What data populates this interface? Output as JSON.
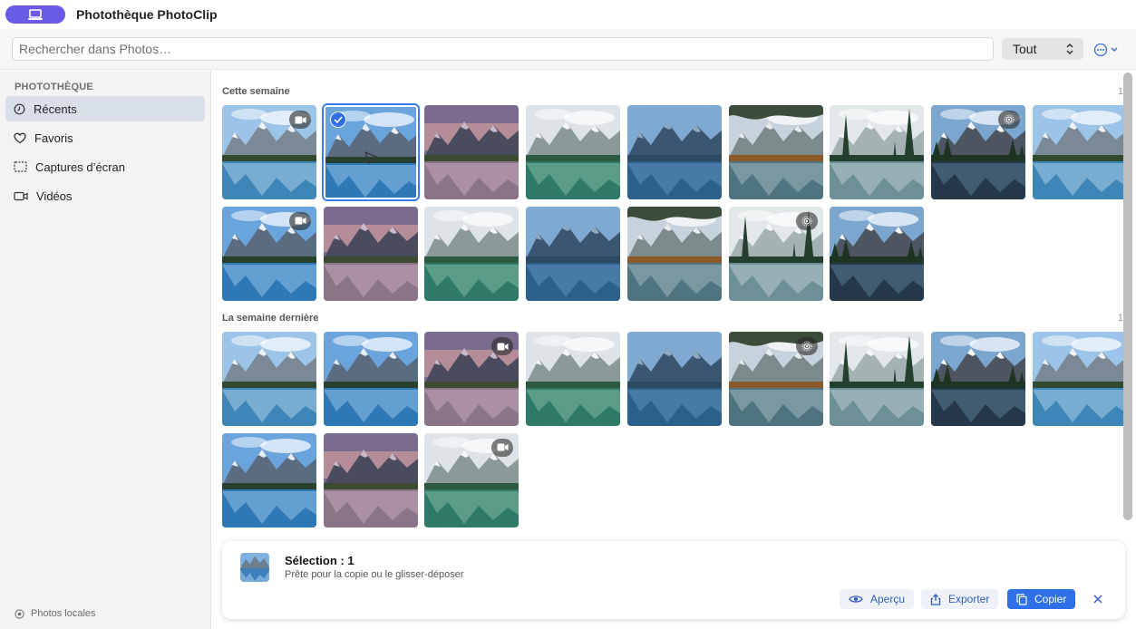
{
  "window": {
    "title": "Photothèque PhotoClip",
    "app_pill_icon": "laptop-icon"
  },
  "toolbar": {
    "search_placeholder": "Rechercher dans Photos…",
    "filter_value": "Tout",
    "more_icon": "ellipsis-circle-icon"
  },
  "sidebar": {
    "heading": "PHOTOTHÈQUE",
    "items": [
      {
        "label": "Récents",
        "icon": "clock-icon",
        "active": true
      },
      {
        "label": "Favoris",
        "icon": "heart-icon",
        "active": false
      },
      {
        "label": "Captures d’écran",
        "icon": "screenshot-icon",
        "active": false
      },
      {
        "label": "Vidéos",
        "icon": "video-icon",
        "active": false
      }
    ],
    "footer": "Photos locales"
  },
  "sections": [
    {
      "title": "Cette semaine",
      "count": "1",
      "photos": [
        {
          "scene": "lake-moraine",
          "badge": "video"
        },
        {
          "scene": "lake-moraine-blue",
          "badge": "none",
          "selected": true
        },
        {
          "scene": "sunset-peaks",
          "badge": "none"
        },
        {
          "scene": "misty-lake",
          "badge": "none"
        },
        {
          "scene": "blue-lake",
          "badge": "none"
        },
        {
          "scene": "autumn-forest",
          "badge": "none"
        },
        {
          "scene": "pine-forest",
          "badge": "none"
        },
        {
          "scene": "snow-peak",
          "badge": "live"
        },
        {
          "scene": "lake-moraine",
          "badge": "none"
        },
        {
          "scene": "lake-moraine-blue",
          "badge": "video"
        },
        {
          "scene": "sunset-peaks",
          "badge": "none"
        },
        {
          "scene": "misty-lake",
          "badge": "none"
        },
        {
          "scene": "blue-lake",
          "badge": "none"
        },
        {
          "scene": "autumn-forest",
          "badge": "none"
        },
        {
          "scene": "pine-forest",
          "badge": "live"
        },
        {
          "scene": "snow-peak",
          "badge": "none"
        }
      ]
    },
    {
      "title": "La semaine dernière",
      "count": "1",
      "photos": [
        {
          "scene": "lake-moraine",
          "badge": "none"
        },
        {
          "scene": "lake-moraine-blue",
          "badge": "none"
        },
        {
          "scene": "sunset-peaks",
          "badge": "video"
        },
        {
          "scene": "misty-lake",
          "badge": "none"
        },
        {
          "scene": "blue-lake",
          "badge": "none"
        },
        {
          "scene": "autumn-forest",
          "badge": "live"
        },
        {
          "scene": "pine-forest",
          "badge": "none"
        },
        {
          "scene": "snow-peak",
          "badge": "none"
        },
        {
          "scene": "lake-moraine",
          "badge": "none"
        },
        {
          "scene": "lake-moraine-blue",
          "badge": "none"
        },
        {
          "scene": "sunset-peaks",
          "badge": "none"
        },
        {
          "scene": "misty-lake",
          "badge": "video"
        }
      ]
    }
  ],
  "selection": {
    "title": "Sélection : 1",
    "subtitle": "Prête pour la copie ou le glisser-déposer",
    "preview_label": "Aperçu",
    "export_label": "Exporter",
    "copy_label": "Copier"
  },
  "colors": {
    "accent": "#2f6fe8",
    "pill": "#6b5ce7",
    "sidebar_active": "#d9dfe9"
  }
}
